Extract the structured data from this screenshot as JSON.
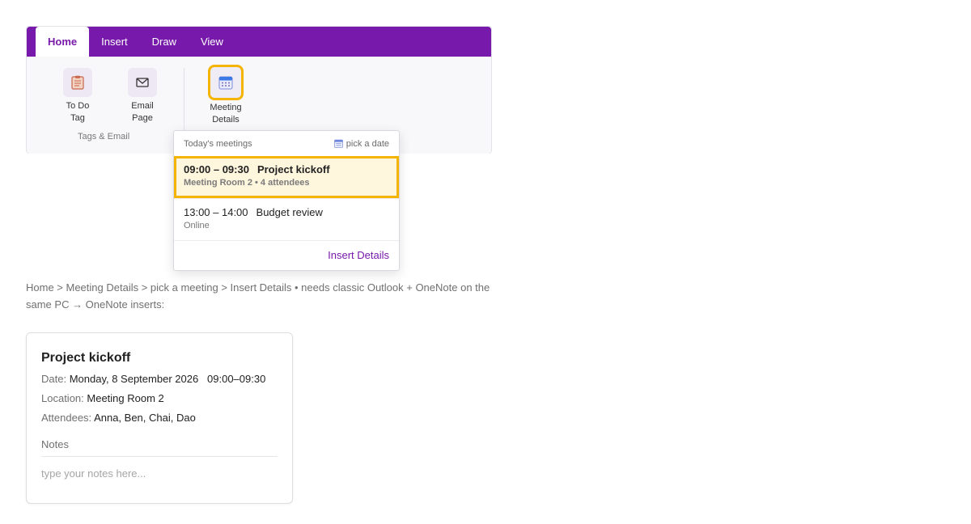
{
  "ribbon": {
    "tabs": [
      {
        "label": "Home",
        "active": true
      },
      {
        "label": "Insert"
      },
      {
        "label": "Draw"
      },
      {
        "label": "View"
      }
    ],
    "buttons": {
      "todo": {
        "line1": "To Do",
        "line2": "Tag",
        "icon": "clipboard-icon"
      },
      "email": {
        "line1": "Email",
        "line2": "Page",
        "icon": "envelope-icon"
      },
      "meeting": {
        "line1": "Meeting",
        "line2": "Details",
        "icon": "calendar-icon"
      }
    },
    "group_label": "Tags & Email",
    "accent": "#7719aa",
    "highlight": "#f4b400"
  },
  "dropdown": {
    "heading": "Today's meetings",
    "pick_date": "pick a date",
    "meetings": [
      {
        "time": "09:00 – 09:30",
        "title": "Project kickoff",
        "detail": "Meeting Room 2 • 4 attendees",
        "selected": true
      },
      {
        "time": "13:00 – 14:00",
        "title": "Budget review",
        "detail": "Online",
        "selected": false
      }
    ],
    "insert_label": "Insert Details"
  },
  "breadcrumb": "Home > Meeting Details > pick a meeting > Insert Details  •  needs classic Outlook + OneNote on the same PC  →  OneNote inserts:",
  "card": {
    "title": "Project kickoff",
    "date_label": "Date:",
    "date_value": "Monday, 8 September 2026   09:00–09:30",
    "location_label": "Location:",
    "location_value": "Meeting Room 2",
    "attendees_label": "Attendees:",
    "attendees_value": "Anna, Ben, Chai, Dao",
    "notes_label": "Notes",
    "notes_placeholder": "type your notes here..."
  }
}
